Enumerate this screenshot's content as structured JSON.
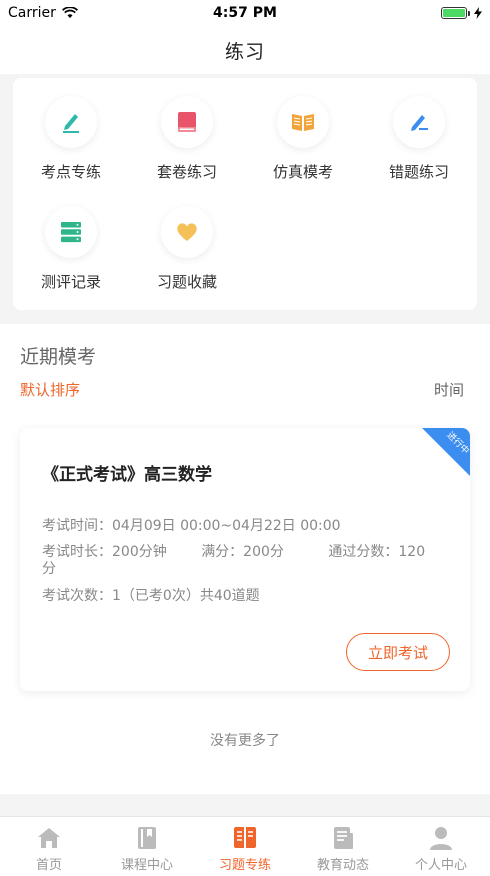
{
  "status": {
    "carrier": "Carrier",
    "time": "4:57 PM",
    "battery_level": 1.0
  },
  "nav": {
    "title": "练习"
  },
  "grid": [
    {
      "label": "考点专练",
      "icon": "pen-icon",
      "color": "#2fb9a8"
    },
    {
      "label": "套卷练习",
      "icon": "book-icon",
      "color": "#e8556a"
    },
    {
      "label": "仿真模考",
      "icon": "open-book-icon",
      "color": "#f2a43a"
    },
    {
      "label": "错题练习",
      "icon": "edit-icon",
      "color": "#3b8ef0"
    },
    {
      "label": "测评记录",
      "icon": "server-icon",
      "color": "#2fb58a"
    },
    {
      "label": "习题收藏",
      "icon": "heart-icon",
      "color": "#f5c057"
    }
  ],
  "recent": {
    "title": "近期模考",
    "sort_default": "默认排序",
    "sort_time": "时间",
    "exam": {
      "badge": "进行中",
      "title": "《正式考试》高三数学",
      "time_label": "考试时间：",
      "time_value": "04月09日 00:00~04月22日 00:00",
      "duration": "考试时长：200分钟",
      "full_score": "满分：200分",
      "pass_score_a": "通过分数：120",
      "pass_score_b": "分",
      "attempts": "考试次数：1（已考0次）共40道题",
      "button": "立即考试"
    },
    "no_more": "没有更多了"
  },
  "tabs": [
    {
      "label": "首页",
      "icon": "home-icon",
      "active": false
    },
    {
      "label": "课程中心",
      "icon": "course-icon",
      "active": false
    },
    {
      "label": "习题专练",
      "icon": "exercise-icon",
      "active": true
    },
    {
      "label": "教育动态",
      "icon": "news-icon",
      "active": false
    },
    {
      "label": "个人中心",
      "icon": "user-icon",
      "active": false
    }
  ],
  "colors": {
    "accent": "#f0652b",
    "ribbon": "#3b8ef0",
    "tab_inactive": "#bbbbbb"
  }
}
